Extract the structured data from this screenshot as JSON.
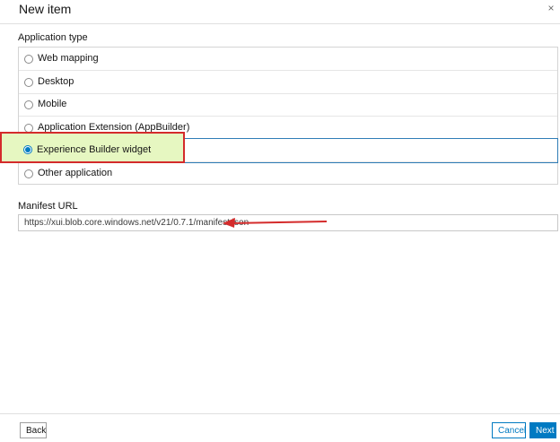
{
  "dialog": {
    "title": "New item",
    "close_symbol": "×"
  },
  "application_type": {
    "label": "Application type",
    "options": [
      {
        "label": "Web mapping",
        "selected": false
      },
      {
        "label": "Desktop",
        "selected": false
      },
      {
        "label": "Mobile",
        "selected": false
      },
      {
        "label": "Application Extension (AppBuilder)",
        "selected": false
      },
      {
        "label": "Experience Builder widget",
        "selected": true
      },
      {
        "label": "Other application",
        "selected": false
      }
    ]
  },
  "manifest": {
    "label": "Manifest URL",
    "value": "https://xui.blob.core.windows.net/v21/0.7.1/manifest.json"
  },
  "footer": {
    "back_label": "Back",
    "cancel_label": "Cancel",
    "next_label": "Next"
  },
  "colors": {
    "accent": "#007ac2",
    "annotation_red": "#d42b2b",
    "highlight_fill": "#e6f7c1"
  },
  "icons": {
    "close": "close-icon",
    "annotation_arrow": "arrow-left-icon"
  }
}
